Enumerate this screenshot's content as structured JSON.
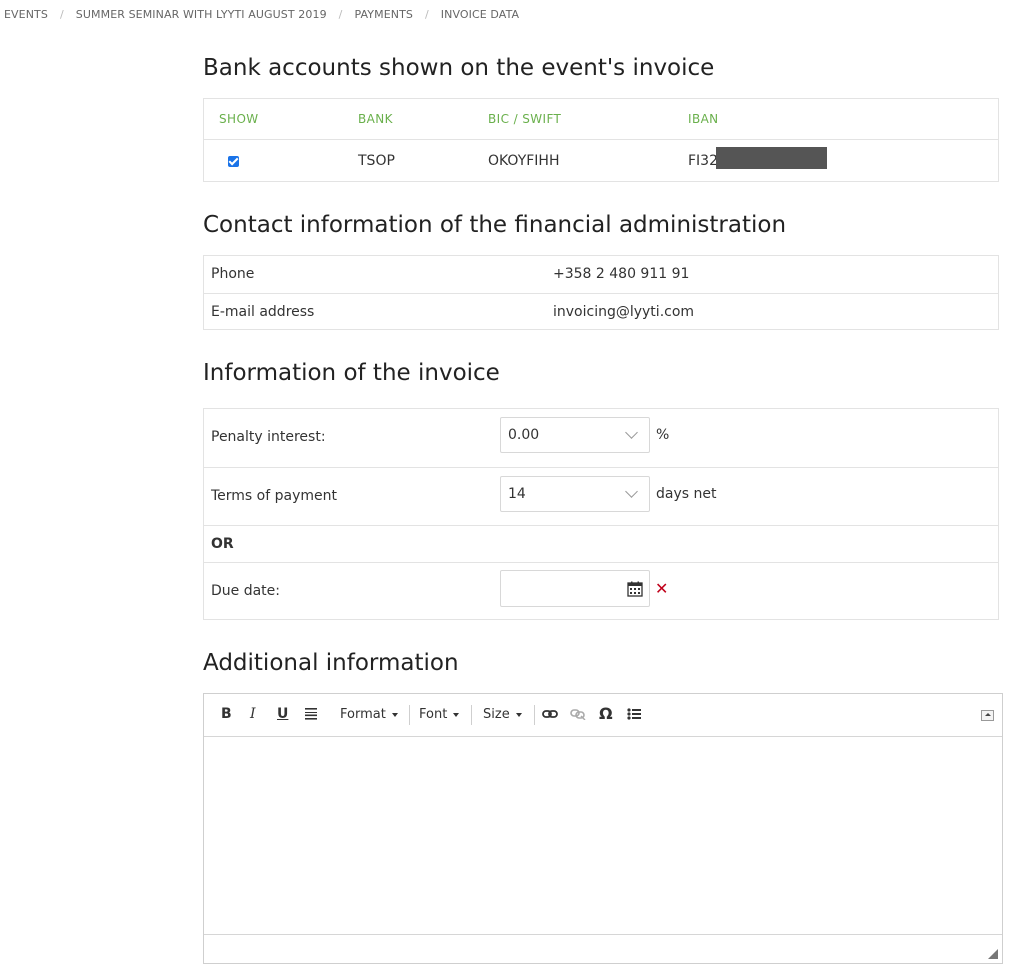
{
  "breadcrumb": [
    {
      "label": "EVENTS"
    },
    {
      "label": "SUMMER SEMINAR WITH LYYTI AUGUST 2019"
    },
    {
      "label": "PAYMENTS"
    },
    {
      "label": "INVOICE DATA"
    }
  ],
  "bank_section": {
    "title": "Bank accounts shown on the event's invoice",
    "headers": {
      "show": "SHOW",
      "bank": "BANK",
      "bic": "BIC / SWIFT",
      "iban": "IBAN"
    },
    "rows": [
      {
        "show": true,
        "bank": "TSOP",
        "bic": "OKOYFIHH",
        "iban": "FI32"
      }
    ]
  },
  "contact_section": {
    "title": "Contact information of the financial administration",
    "rows": [
      {
        "label": "Phone",
        "value": "+358 2 480 911 91"
      },
      {
        "label": "E-mail address",
        "value": "invoicing@lyyti.com"
      }
    ]
  },
  "invoice_section": {
    "title": "Information of the invoice",
    "penalty": {
      "label": "Penalty interest:",
      "value": "0.00",
      "unit": "%"
    },
    "terms": {
      "label": "Terms of payment",
      "value": "14",
      "unit": "days net"
    },
    "or_label": "OR",
    "due_date": {
      "label": "Due date:",
      "value": ""
    }
  },
  "additional_section": {
    "title": "Additional information",
    "toolbar": {
      "bold": "B",
      "italic": "I",
      "underline": "U",
      "format": "Format",
      "font": "Font",
      "size": "Size",
      "special_char": "Ω"
    }
  },
  "colors": {
    "accent_green": "#6ab04c",
    "checkbox_blue": "#1a73e8",
    "clear_red": "#c0001a"
  }
}
